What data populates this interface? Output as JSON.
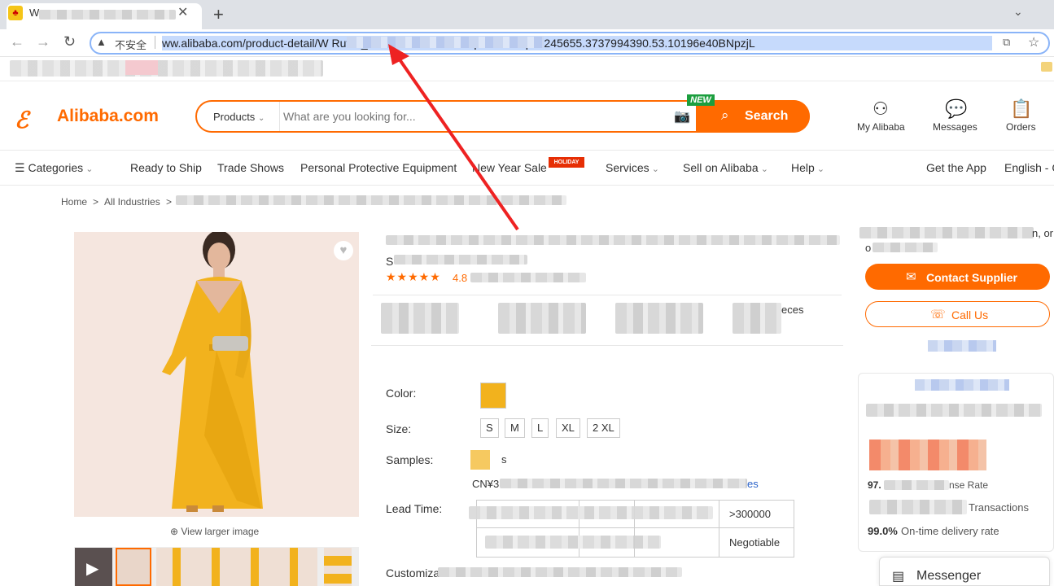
{
  "browser": {
    "tab_title": "W",
    "new_tab": "+",
    "security_label": "不安全",
    "url": "ww.alibaba.com/product-detail/W                                          Ruffle_62157022375.html?spm=a27aq.13245655.3737994390.53.10196e40BNpzjL"
  },
  "header": {
    "logo_text": "Alibaba.com",
    "search_category": "Products",
    "search_placeholder": "What are you looking for...",
    "search_button": "Search",
    "new_badge": "NEW",
    "account": "My Alibaba",
    "messages": "Messages",
    "orders": "Orders"
  },
  "nav": {
    "categories": "Categories",
    "ready_to_ship": "Ready to Ship",
    "trade_shows": "Trade Shows",
    "ppe": "Personal Protective Equipment",
    "new_year_sale": "New Year Sale",
    "holiday_badge": "HOLIDAY",
    "services": "Services",
    "sell": "Sell on Alibaba",
    "help": "Help",
    "get_app": "Get the App",
    "language": "English - C"
  },
  "breadcrumb": {
    "home": "Home",
    "sep": ">",
    "all_industries": "All Industries",
    "sep2": ">"
  },
  "gallery": {
    "view_larger": "View larger image"
  },
  "product": {
    "title_fragment": "S",
    "rating": "4.8",
    "pieces_fragment": "eces",
    "color_label": "Color:",
    "size_label": "Size:",
    "sizes": [
      "S",
      "M",
      "L",
      "XL",
      "2 XL"
    ],
    "samples_label": "Samples:",
    "samples_fragment": "s",
    "sample_price": "CN¥3",
    "sample_link_fragment": "es",
    "lead_time_label": "Lead Time:",
    "lead_qty": ">300000",
    "lead_negotiable": "Negotiable",
    "customization_label": "Customization:"
  },
  "supplier": {
    "top_fragment": "n, or",
    "top_fragment2": "o",
    "contact": "Contact Supplier",
    "call": "Call Us",
    "response_fragment": "97.",
    "response_rate_fragment": "nse Rate",
    "transactions_fragment": "Transactions",
    "on_time_value": "99.0%",
    "on_time_label": "On-time delivery rate"
  },
  "messenger": {
    "label": "Messenger"
  }
}
